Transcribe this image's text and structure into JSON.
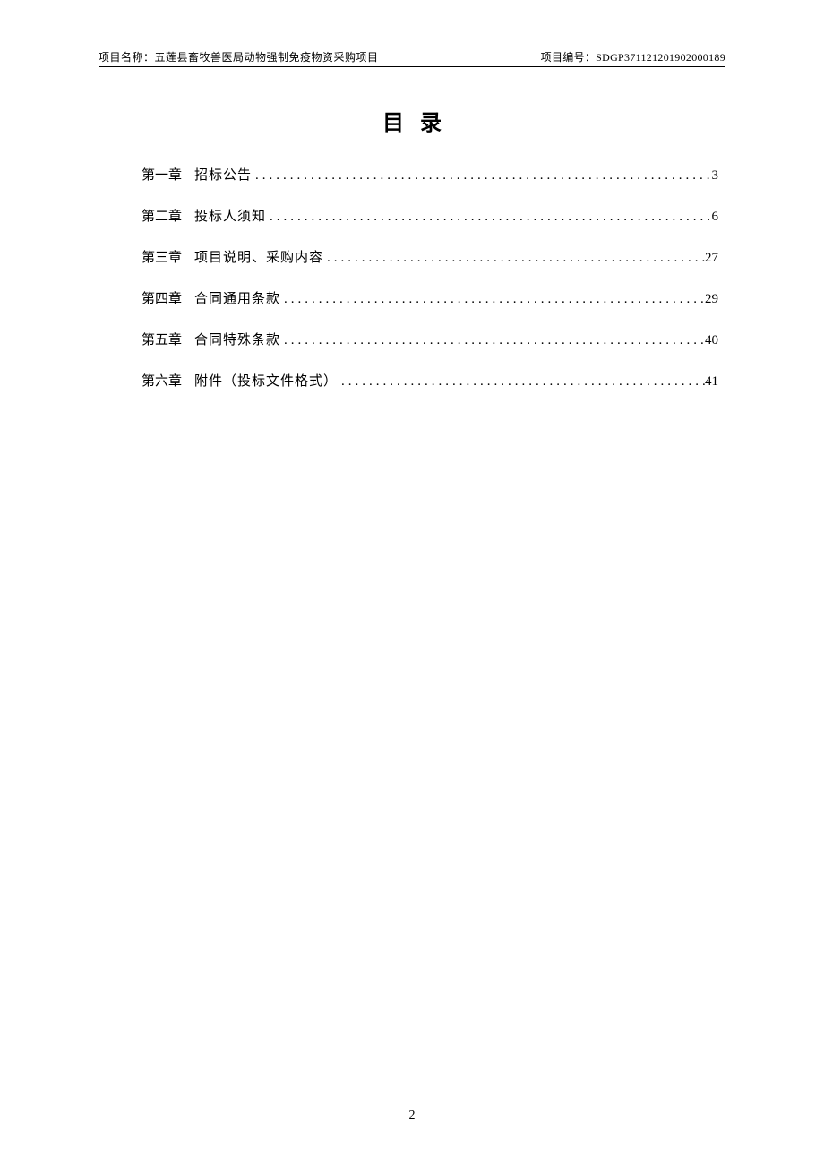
{
  "header": {
    "project_label": "项目名称：",
    "project_name": "五莲县畜牧兽医局动物强制免疫物资采购项目",
    "code_label": "项目编号：",
    "code_value": "SDGP371121201902000189"
  },
  "title": "目录",
  "toc": [
    {
      "chapter": "第一章",
      "name": "招标公告",
      "page": "3"
    },
    {
      "chapter": "第二章",
      "name": "投标人须知",
      "page": "6"
    },
    {
      "chapter": "第三章",
      "name": "项目说明、采购内容",
      "page": "27"
    },
    {
      "chapter": "第四章",
      "name": "合同通用条款",
      "page": "29"
    },
    {
      "chapter": "第五章",
      "name": "合同特殊条款",
      "page": "40"
    },
    {
      "chapter": "第六章",
      "name": "附件（投标文件格式）",
      "page": "41"
    }
  ],
  "page_number": "2"
}
